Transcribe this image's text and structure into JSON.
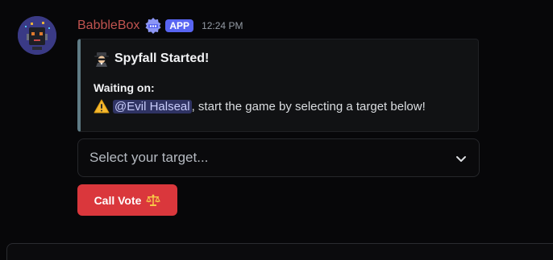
{
  "message": {
    "username": "BabbleBox",
    "app_tag": "APP",
    "timestamp": "12:24 PM",
    "embed": {
      "title": "Spyfall Started!",
      "field_name": "Waiting on:",
      "mention": "@Evil Halseal",
      "field_text": ", start the game by selecting a target below!",
      "accent_color": "#5f7b85"
    },
    "select": {
      "placeholder": "Select your target..."
    },
    "button": {
      "label": "Call Vote",
      "color": "#da373c"
    }
  },
  "colors": {
    "username": "#c0534f",
    "app_tag": "#5865f2",
    "mention_bg": "#2f3363"
  },
  "icons": {
    "avatar": "robot-avatar-icon",
    "verified": "bot-verified-icon",
    "title": "spy-icon",
    "field": "warning-icon",
    "select": "chevron-down-icon",
    "button": "balance-scale-icon"
  }
}
